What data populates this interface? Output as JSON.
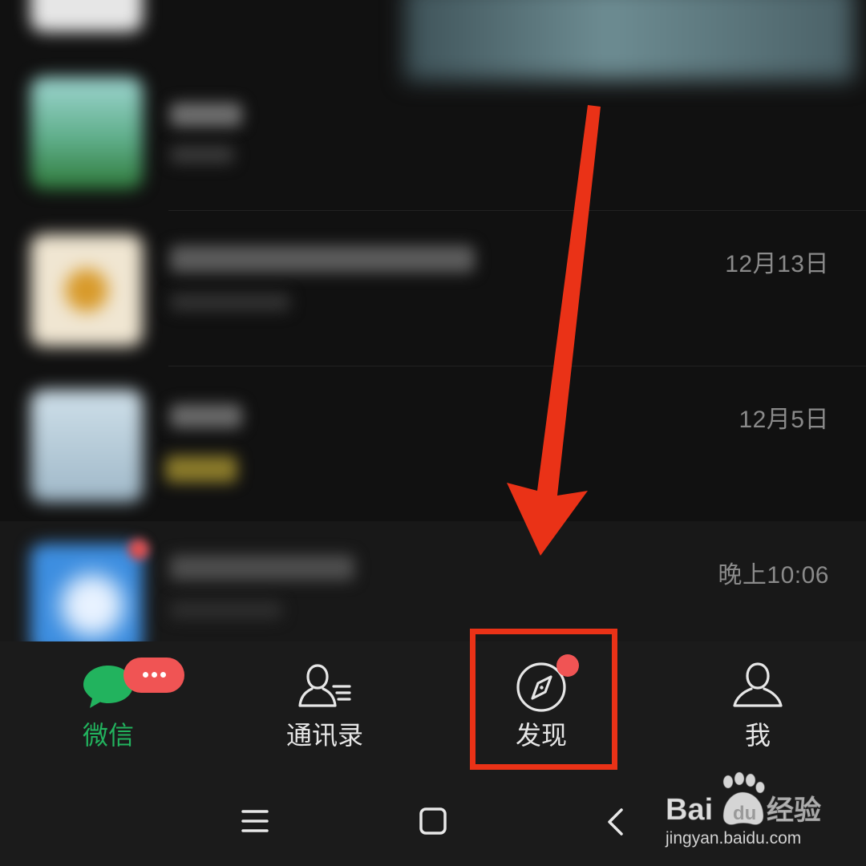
{
  "chat_list": {
    "rows": [
      {
        "time": ""
      },
      {
        "time": ""
      },
      {
        "time": "12月13日"
      },
      {
        "time": "12月5日"
      },
      {
        "time": "晚上10:06"
      }
    ]
  },
  "tab_bar": {
    "tabs": [
      {
        "label": "微信",
        "icon": "chat-bubble-icon",
        "active": true
      },
      {
        "label": "通讯录",
        "icon": "contacts-icon",
        "active": false
      },
      {
        "label": "发现",
        "icon": "compass-icon",
        "active": false
      },
      {
        "label": "我",
        "icon": "person-icon",
        "active": false
      }
    ]
  },
  "system_nav": {
    "buttons": [
      "menu-icon",
      "home-square-icon",
      "back-chevron-icon"
    ]
  },
  "annotation": {
    "arrow": "red-arrow-pointing-down",
    "highlight": "red-rectangle-around-discover-tab"
  },
  "watermark": {
    "brand_latin": "Bai",
    "brand_du": "du",
    "brand_cn": "经验",
    "url": "jingyan.baidu.com"
  },
  "colors": {
    "background": "#111111",
    "bar_background": "#1b1b1b",
    "active_green": "#22b35e",
    "badge_red": "#f05454",
    "annotation_red": "#ea3217",
    "time_gray": "#8a8a8a"
  }
}
